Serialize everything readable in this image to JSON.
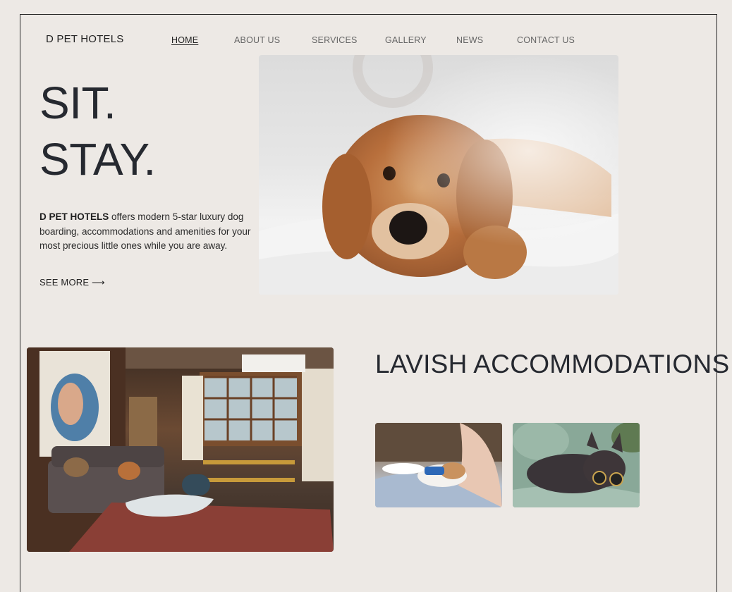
{
  "brand": "D PET HOTELS",
  "nav": {
    "items": [
      {
        "label": "HOME",
        "active": true
      },
      {
        "label": "ABOUT US",
        "active": false
      },
      {
        "label": "SERVICES",
        "active": false
      },
      {
        "label": "GALLERY",
        "active": false
      },
      {
        "label": "NEWS",
        "active": false
      },
      {
        "label": "CONTACT US",
        "active": false
      }
    ]
  },
  "hero": {
    "title_line1": "SIT.",
    "title_line2": "STAY.",
    "text_bold": "D PET HOTELS",
    "text_rest": " offers modern 5-star luxury dog boarding, accommodations and amenities for your most precious little ones while you are away.",
    "see_more": "SEE MORE ⟶"
  },
  "accommodations": {
    "title": "LAVISH ACCOMMODATIONS"
  },
  "images": {
    "hero": "golden-doodle-on-bed-photo",
    "room": "living-room-interior-photo",
    "thumb1": "person-with-dog-photo",
    "thumb2": "bulldog-with-sunglasses-photo"
  },
  "colors": {
    "background": "#ede9e5",
    "text": "#23262b",
    "nav_text": "#666666"
  }
}
